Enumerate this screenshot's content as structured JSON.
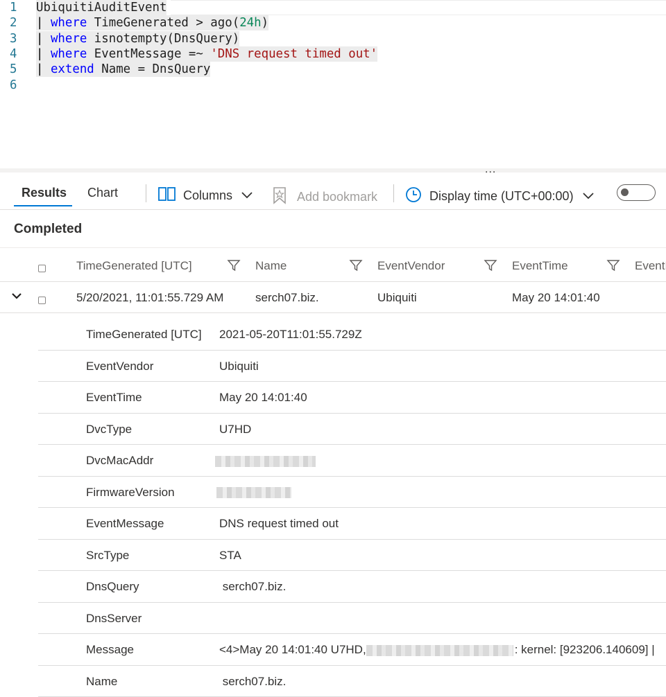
{
  "editor": {
    "lines": [
      {
        "num": "1",
        "parts": [
          {
            "t": "UbiquitiAuditEvent",
            "c": ""
          }
        ]
      },
      {
        "num": "2",
        "parts": [
          {
            "t": "| ",
            "c": "bar"
          },
          {
            "t": "where",
            "c": "kw"
          },
          {
            "t": " TimeGenerated > ago(",
            "c": ""
          },
          {
            "t": "24h",
            "c": "num"
          },
          {
            "t": ")",
            "c": ""
          }
        ]
      },
      {
        "num": "3",
        "parts": [
          {
            "t": "| ",
            "c": "bar"
          },
          {
            "t": "where",
            "c": "kw"
          },
          {
            "t": " isnotempty(DnsQuery)",
            "c": ""
          }
        ]
      },
      {
        "num": "4",
        "parts": [
          {
            "t": "| ",
            "c": "bar"
          },
          {
            "t": "where",
            "c": "kw"
          },
          {
            "t": " EventMessage =~ ",
            "c": ""
          },
          {
            "t": "'DNS request timed out'",
            "c": "str"
          }
        ]
      },
      {
        "num": "5",
        "parts": [
          {
            "t": "| ",
            "c": "bar"
          },
          {
            "t": "extend",
            "c": "kw"
          },
          {
            "t": " Name = DnsQuery",
            "c": ""
          }
        ]
      },
      {
        "num": "6",
        "parts": []
      }
    ],
    "splitter_handle": "..."
  },
  "toolbar": {
    "tab_results": "Results",
    "tab_chart": "Chart",
    "columns_label": "Columns",
    "add_bookmark_label": "Add bookmark",
    "display_time_label": "Display time (UTC+00:00)"
  },
  "status": "Completed",
  "grid": {
    "columns": [
      "TimeGenerated [UTC]",
      "Name",
      "EventVendor",
      "EventTime",
      "EventM"
    ],
    "row": {
      "time_generated": "5/20/2021, 11:01:55.729 AM",
      "name": "serch07.biz.",
      "event_vendor": "Ubiquiti",
      "event_time": "May 20 14:01:40"
    }
  },
  "detail": [
    {
      "key": "TimeGenerated [UTC]",
      "value": "2021-05-20T11:01:55.729Z"
    },
    {
      "key": "EventVendor",
      "value": "Ubiquiti"
    },
    {
      "key": "EventTime",
      "value": "May 20 14:01:40"
    },
    {
      "key": "DvcType",
      "value": "U7HD"
    },
    {
      "key": "DvcMacAddr",
      "value": ""
    },
    {
      "key": "FirmwareVersion",
      "value": ""
    },
    {
      "key": "EventMessage",
      "value": "DNS request timed out"
    },
    {
      "key": "SrcType",
      "value": "STA"
    },
    {
      "key": "DnsQuery",
      "value": " serch07.biz."
    },
    {
      "key": "DnsServer",
      "value": ""
    },
    {
      "key": "Message",
      "value": "<4>May 20 14:01:40 U7HD,",
      "value_suffix": ": kernel: [923206.140609] |"
    },
    {
      "key": "Name",
      "value": " serch07.biz."
    }
  ],
  "colors": {
    "accent": "#0078d4",
    "keyword": "#0000ff",
    "string": "#a31515",
    "number": "#098658",
    "line_number": "#237893"
  }
}
